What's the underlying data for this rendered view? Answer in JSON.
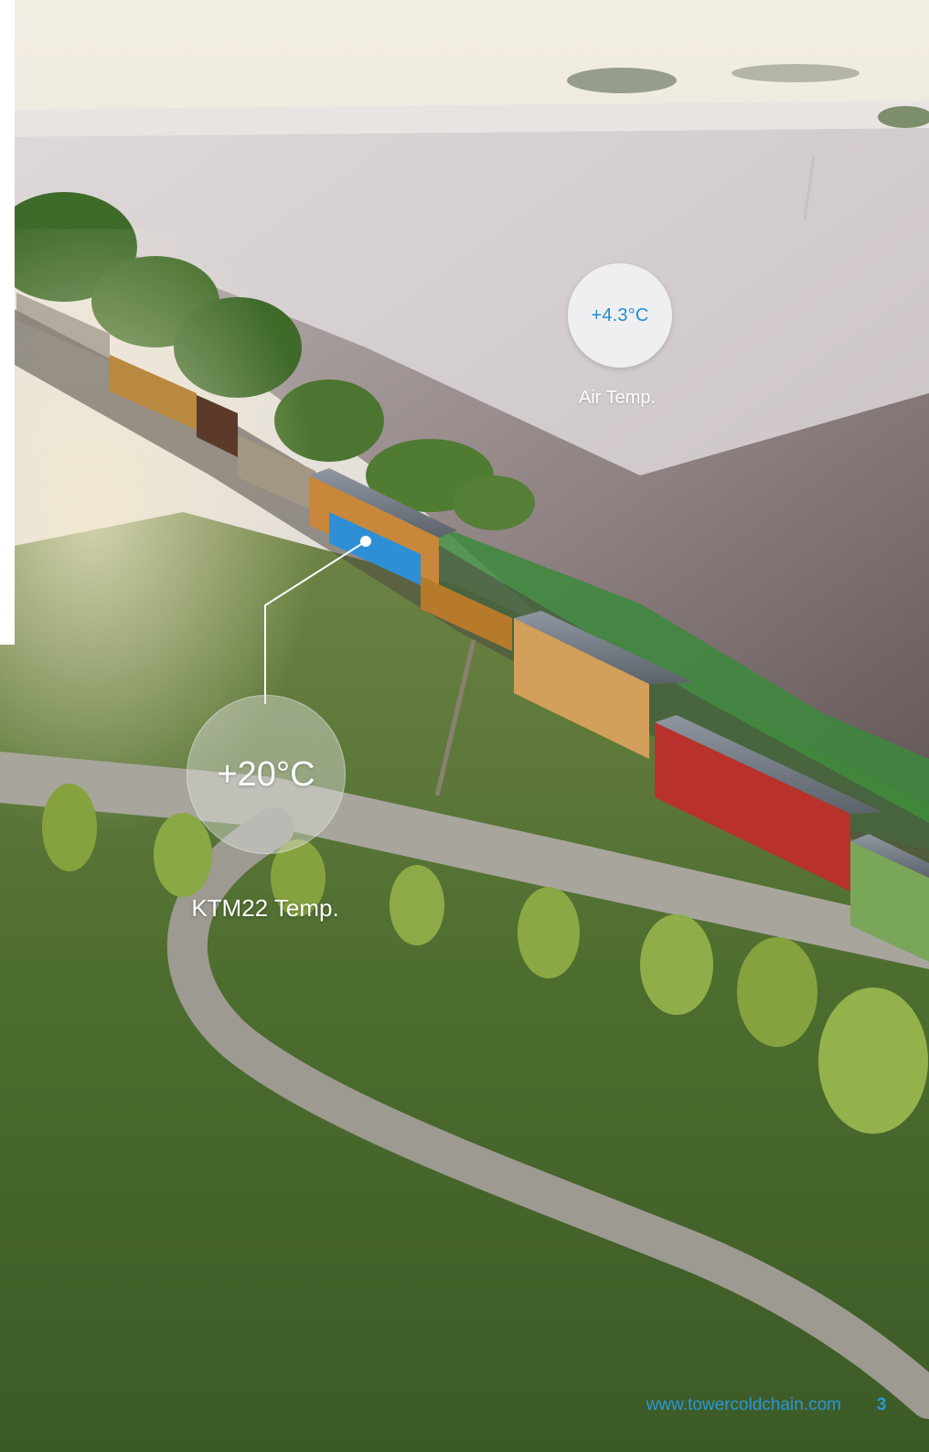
{
  "readings": {
    "air": {
      "value": "+4.3°C",
      "label": "Air Temp."
    },
    "ktm22": {
      "value": "+20°C",
      "label": "KTM22 Temp."
    }
  },
  "footer": {
    "url": "www.towercoldchain.com",
    "page_number": "3"
  },
  "colors": {
    "accent": "#2a97d6",
    "container_blue": "#2e8fd6",
    "car_red": "#b8322b",
    "car_orange": "#c8873a",
    "car_green": "#7aa65a",
    "grass": "#4e6e2e",
    "fog": "#d9d6d8"
  }
}
